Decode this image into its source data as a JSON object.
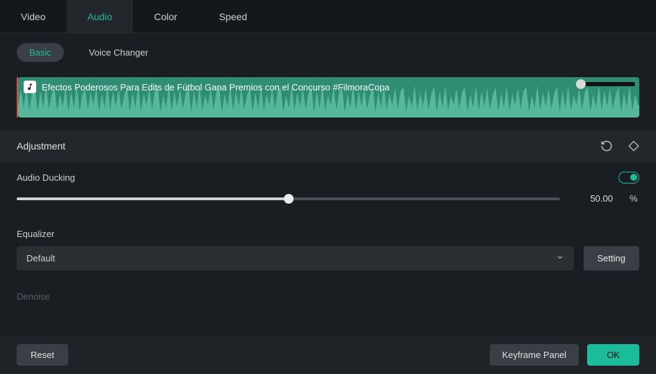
{
  "tabs": {
    "video": "Video",
    "audio": "Audio",
    "color": "Color",
    "speed": "Speed"
  },
  "subtabs": {
    "basic": "Basic",
    "voice_changer": "Voice Changer"
  },
  "clip": {
    "title": "Efectos Poderosos Para Edits de Fútbol   Gana Premios con el Concurso #FilmoraCopa"
  },
  "adjustment": {
    "title": "Adjustment"
  },
  "ducking": {
    "label": "Audio Ducking",
    "value": "50.00",
    "unit": "%"
  },
  "equalizer": {
    "label": "Equalizer",
    "selected": "Default",
    "setting": "Setting"
  },
  "denoise": {
    "label": "Denoise"
  },
  "footer": {
    "reset": "Reset",
    "keyframe": "Keyframe Panel",
    "ok": "OK"
  }
}
